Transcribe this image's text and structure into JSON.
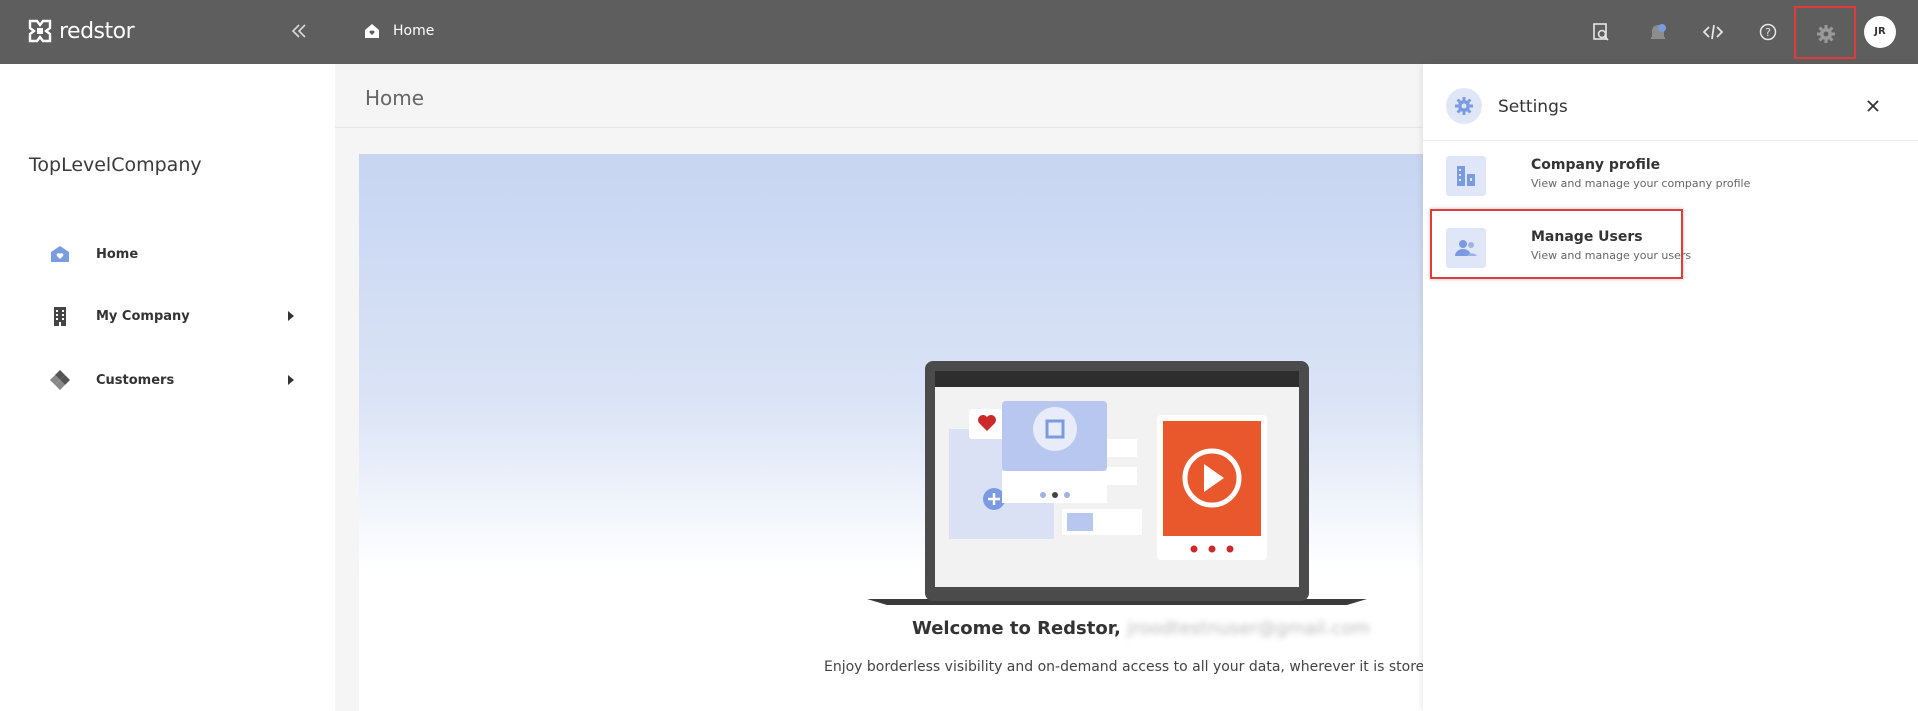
{
  "app": {
    "brand": "redstor"
  },
  "topbar": {
    "breadcrumb": "Home",
    "avatar_initials": "JR",
    "icons": [
      "search-doc-icon",
      "notification-icon",
      "code-icon",
      "help-icon",
      "gear-icon"
    ]
  },
  "sidebar": {
    "company": "TopLevelCompany",
    "items": [
      {
        "label": "Home",
        "icon": "home-icon"
      },
      {
        "label": "My Company",
        "icon": "building-icon"
      },
      {
        "label": "Customers",
        "icon": "customers-icon"
      }
    ]
  },
  "main": {
    "title": "Home",
    "welcome_prefix": "Welcome to Redstor,",
    "welcome_email": "jroodtestnuser@gmail.com",
    "subtext": "Enjoy borderless visibility and on-demand access to all your data, wherever it is stored"
  },
  "settings_panel": {
    "title": "Settings",
    "options": [
      {
        "title": "Company profile",
        "desc": "View and manage your company profile",
        "icon": "company-profile-icon"
      },
      {
        "title": "Manage Users",
        "desc": "View and manage your users",
        "icon": "users-icon"
      }
    ]
  },
  "colors": {
    "accent": "#7b9be0",
    "highlight": "#e03b3b",
    "topbar": "#5e5e5e"
  }
}
